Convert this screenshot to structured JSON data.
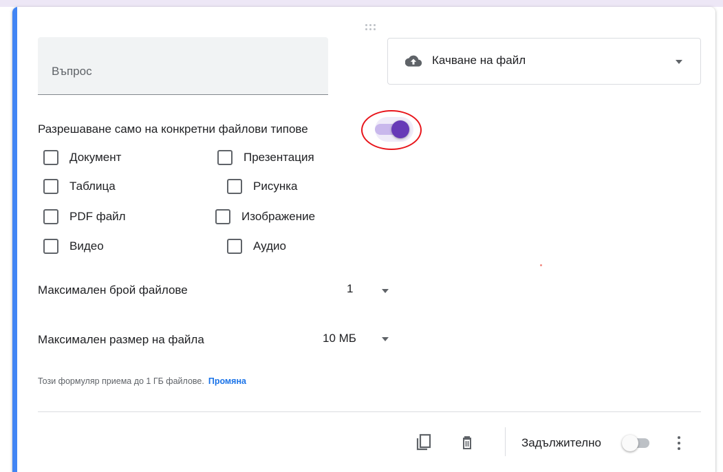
{
  "question": {
    "placeholder": "Въпрос"
  },
  "question_type": {
    "label": "Качване на файл",
    "icon": "cloud-upload-icon"
  },
  "restrict_types": {
    "label": "Разрешаване само на конкретни файлови типове",
    "enabled": true,
    "accent_color": "#673ab7",
    "highlight_color": "#e8151b"
  },
  "file_types": [
    {
      "label": "Документ",
      "checked": false
    },
    {
      "label": "Презентация",
      "checked": false
    },
    {
      "label": "Таблица",
      "checked": false
    },
    {
      "label": "Рисунка",
      "checked": false
    },
    {
      "label": "PDF файл",
      "checked": false
    },
    {
      "label": "Изображение",
      "checked": false
    },
    {
      "label": "Видео",
      "checked": false
    },
    {
      "label": "Аудио",
      "checked": false
    }
  ],
  "max_files": {
    "label": "Максимален брой файлове",
    "value": "1"
  },
  "max_size": {
    "label": "Максимален размер на файла",
    "value": "10 МБ"
  },
  "storage_note": {
    "text": "Този формуляр приема до 1 ГБ файлове.",
    "change_link": "Промяна"
  },
  "footer": {
    "copy_icon": "copy-icon",
    "delete_icon": "trash-icon",
    "required_label": "Задължително",
    "required_enabled": false,
    "more_icon": "more-vert-icon"
  },
  "colors": {
    "card_accent": "#4285f4",
    "link": "#1a73e8"
  }
}
